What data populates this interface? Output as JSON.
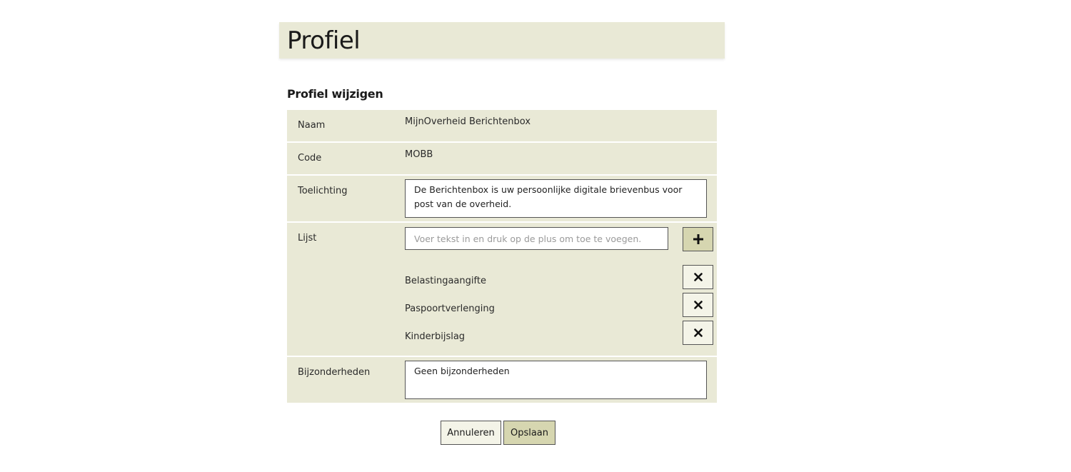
{
  "page": {
    "title": "Profiel"
  },
  "form": {
    "section_title": "Profiel wijzigen",
    "naam": {
      "label": "Naam",
      "value": "MijnOverheid Berichtenbox"
    },
    "code": {
      "label": "Code",
      "value": "MOBB"
    },
    "toelichting": {
      "label": "Toelichting",
      "value": "De Berichtenbox is uw persoonlijke digitale brievenbus voor post van de overheid."
    },
    "lijst": {
      "label": "Lijst",
      "input_placeholder": "Voer tekst in en druk op de plus om toe te voegen.",
      "input_value": "",
      "add_icon": "plus-icon",
      "remove_icon": "times-icon",
      "items": [
        "Belastingaangifte",
        "Paspoortverlenging",
        "Kinderbijslag"
      ]
    },
    "bijzonderheden": {
      "label": "Bijzonderheden",
      "value": "Geen bijzonderheden"
    }
  },
  "actions": {
    "cancel_label": "Annuleren",
    "save_label": "Opslaan"
  },
  "colors": {
    "panel_bg": "#e9e9d6",
    "primary_button": "#d6d6b0",
    "secondary_button": "#f4f4e8",
    "border": "#555555"
  }
}
